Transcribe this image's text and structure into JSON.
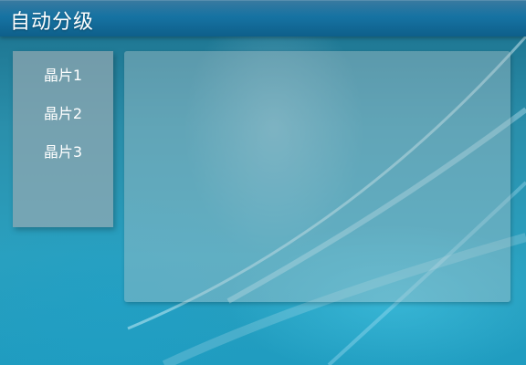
{
  "window": {
    "title": "自动分级"
  },
  "sidebar": {
    "items": [
      {
        "label": "晶片1"
      },
      {
        "label": "晶片2"
      },
      {
        "label": "晶片3"
      }
    ]
  }
}
